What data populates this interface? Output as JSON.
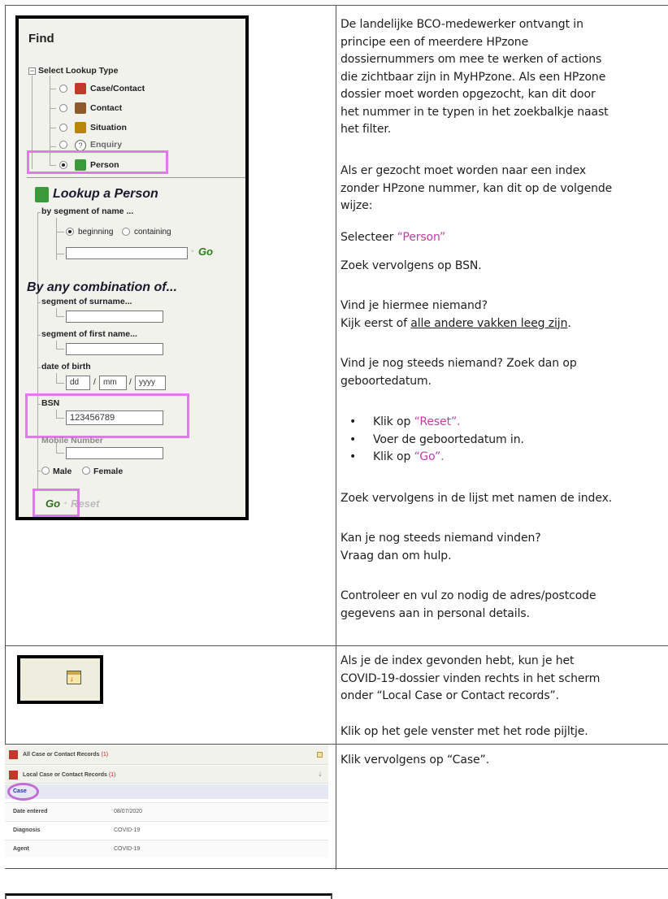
{
  "text": {
    "p1": [
      "De landelijke BCO-medewerker ontvangt in",
      "principe een of meerdere HPzone",
      "dossiernummers om mee te werken of actions",
      "die zichtbaar zijn in MyHPzone. Als een HPzone",
      "dossier moet worden opgezocht, kan dit door",
      "het nummer in te typen in het zoekbalkje naast",
      "het filter."
    ],
    "p2": [
      "Als er gezocht moet worden naar een index",
      "zonder HPzone nummer, kan dit op de volgende",
      "wijze:"
    ],
    "select_prefix": "Selecteer ",
    "select_value": "“Person”",
    "zoek_bsn": "Zoek vervolgens op BSN.",
    "vind1": "Vind je hiermee niemand?",
    "kijk_prefix": "Kijk eerst of ",
    "kijk_link": "alle andere vakken leeg zijn",
    "kijk_suffix": ".",
    "vind2": [
      "Vind je nog steeds niemand? Zoek dan op",
      "geboortedatum."
    ],
    "bullet1_prefix": "Klik op ",
    "bullet1_value": "“Reset”.",
    "bullet2": "Voer de geboortedatum in.",
    "bullet3_prefix": "Klik op ",
    "bullet3_value": "“Go”.",
    "zoek_lijst": "Zoek vervolgens in de lijst met namen de index.",
    "kan_je": [
      "Kan je nog steeds niemand vinden?",
      "Vraag dan om hulp."
    ],
    "controleer": [
      "Controleer en vul zo nodig de adres/postcode",
      "gegevens aan in personal details."
    ],
    "als_je": [
      "Als je de index gevonden hebt, kun je het",
      "COVID-19-dossier vinden rechts in het scherm",
      "onder “Local Case or Contact records”."
    ],
    "klik_gele": "Klik op het gele venster met het rode pijltje.",
    "klik_case": "Klik vervolgens op “Case”."
  },
  "hpzone": {
    "find_title": "Find",
    "select_lookup_type": "Select Lookup Type",
    "lookup_types": [
      {
        "label": "Case/Contact",
        "selected": false,
        "icon": "case-contact-icon",
        "color": "#c0392b"
      },
      {
        "label": "Contact",
        "selected": false,
        "icon": "contact-icon",
        "color": "#8e5a2b"
      },
      {
        "label": "Situation",
        "selected": false,
        "icon": "situation-icon",
        "color": "#b8860b"
      },
      {
        "label": "Enquiry",
        "selected": false,
        "icon": "enquiry-icon",
        "color": "#666666"
      },
      {
        "label": "Person",
        "selected": true,
        "icon": "person-icon",
        "color": "#3a9a3a"
      }
    ],
    "lookup_person_title": "Lookup a Person",
    "by_segment": "by segment of name ...",
    "beginning": "beginning",
    "containing": "containing",
    "go": "Go",
    "by_any": "By any combination of...",
    "segment_surname": "segment of surname...",
    "segment_firstname": "segment of first name...",
    "date_of_birth": "date of birth",
    "dob_dd": "dd",
    "dob_mm": "mm",
    "dob_yyyy": "yyyy",
    "bsn_label": "BSN",
    "bsn_value": "123456789",
    "mobile_label": "Mobile Number",
    "male": "Male",
    "female": "Female",
    "reset": "Reset",
    "highlight_color": "#e07ae8"
  },
  "records": {
    "all_records_label": "All Case or Contact Records",
    "all_records_count": "(1)",
    "local_records_label": "Local Case or Contact Records",
    "local_records_count": "(1)",
    "case_tab": "Case",
    "rows": [
      {
        "label": "Date entered",
        "value": "08/07/2020"
      },
      {
        "label": "Diagnosis",
        "value": "COVID-19"
      },
      {
        "label": "Agent",
        "value": "COVID-19"
      }
    ]
  }
}
